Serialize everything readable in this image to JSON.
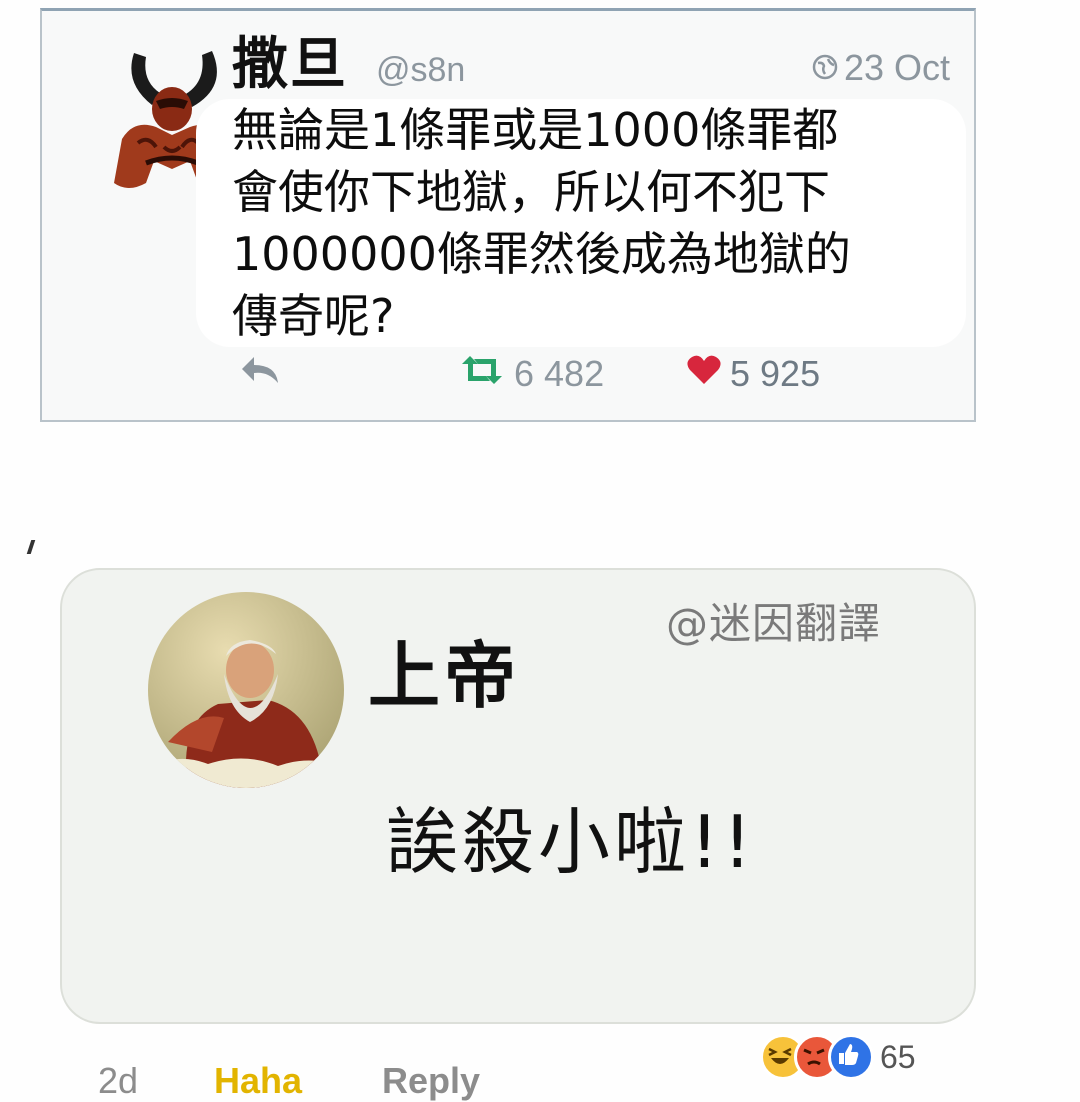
{
  "tweet": {
    "name": "撒旦",
    "handle": "@s8n",
    "time": "23 Oct",
    "text_lines": [
      "無論是1條罪或是1000條罪都",
      "會使你下地獄，所以何不犯下",
      "1000000條罪然後成為地獄的",
      "傳奇呢?"
    ],
    "retweets": "6 482",
    "likes": "5 925",
    "icons": [
      "globe-icon",
      "reply-icon",
      "retweet-icon",
      "heart-icon"
    ],
    "colors": {
      "retweet": "#2aa36b",
      "heart": "#d7263d",
      "muted": "#8c969e"
    }
  },
  "comment": {
    "watermark": "@迷因翻譯",
    "name": "上帝",
    "text": "誒殺小啦!!",
    "reactions": [
      "haha",
      "angry",
      "like"
    ],
    "reaction_count": "65",
    "footer": {
      "age": "2d",
      "haha_label": "Haha",
      "reply_label": "Reply"
    }
  }
}
